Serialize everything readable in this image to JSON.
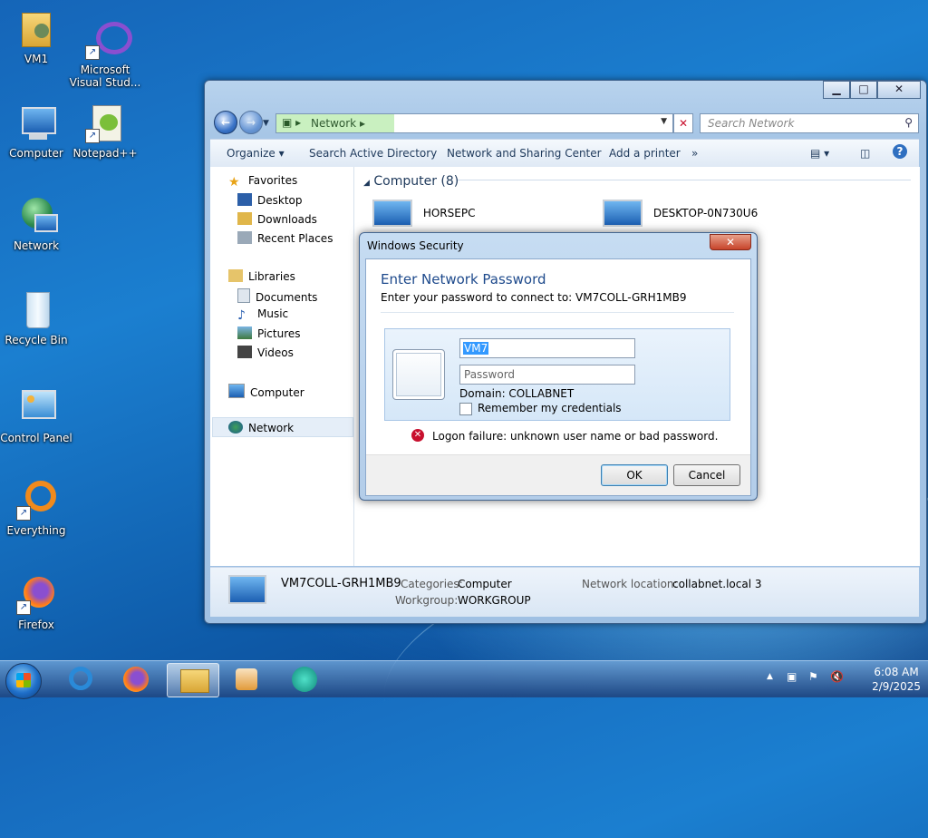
{
  "desktop": {
    "icons": [
      {
        "label": "VM1"
      },
      {
        "label": "Microsoft Visual Stud..."
      },
      {
        "label": "Computer"
      },
      {
        "label": "Notepad++"
      },
      {
        "label": "Network"
      },
      {
        "label": "Recycle Bin"
      },
      {
        "label": "Control Panel"
      },
      {
        "label": "Everything"
      },
      {
        "label": "Firefox"
      }
    ]
  },
  "explorer": {
    "address": "Network",
    "search_placeholder": "Search Network",
    "toolbar": [
      "Organize",
      "Search Active Directory",
      "Network and Sharing Center",
      "Add a printer",
      "»"
    ],
    "nav": {
      "favorites": "Favorites",
      "desktop": "Desktop",
      "downloads": "Downloads",
      "recent": "Recent Places",
      "libraries": "Libraries",
      "documents": "Documents",
      "music": "Music",
      "pictures": "Pictures",
      "videos": "Videos",
      "computer": "Computer",
      "network": "Network"
    },
    "group_header": "Computer (8)",
    "computers": [
      "HORSEPC",
      "DESKTOP-0N730U6"
    ],
    "details": {
      "name": "VM7COLL-GRH1MB9",
      "categories_label": "Categories:",
      "categories_value": "Computer",
      "workgroup_label": "Workgroup:",
      "workgroup_value": "WORKGROUP",
      "location_label": "Network location:",
      "location_value": "collabnet.local 3"
    }
  },
  "dialog": {
    "title": "Windows Security",
    "heading": "Enter Network Password",
    "subtitle": "Enter your password to connect to: VM7COLL-GRH1MB9",
    "username_value": "VM7",
    "password_placeholder": "Password",
    "domain": "Domain: COLLABNET",
    "remember": "Remember my credentials",
    "error": "Logon failure: unknown user name or bad password.",
    "ok": "OK",
    "cancel": "Cancel"
  },
  "taskbar": {
    "time": "6:08 AM",
    "date": "2/9/2025"
  },
  "colors": {
    "heading_blue": "#1e4a8c",
    "error_red": "#c8102e",
    "selection_blue": "#3399ff"
  }
}
